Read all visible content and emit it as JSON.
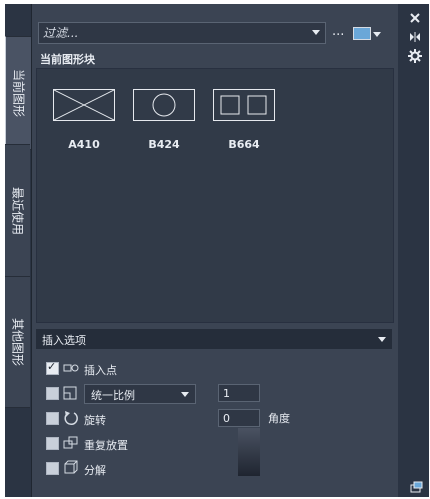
{
  "tabs": [
    {
      "label": "当前图形",
      "active": true
    },
    {
      "label": "最近使用",
      "active": false
    },
    {
      "label": "其他图形",
      "active": false
    }
  ],
  "filter": {
    "placeholder": "过滤...",
    "more_label": "..."
  },
  "section": {
    "title": "当前图形块"
  },
  "blocks": [
    {
      "name": "A410",
      "icon": "rectangle-cross-icon"
    },
    {
      "name": "B424",
      "icon": "rectangle-circle-icon"
    },
    {
      "name": "B664",
      "icon": "rectangle-two-squares-icon"
    }
  ],
  "insert_options": {
    "title": "插入选项",
    "insertion_point": {
      "label": "插入点",
      "checked": true
    },
    "scale": {
      "checked": false,
      "selected": "统一比例",
      "value": "1"
    },
    "rotation": {
      "label": "旋转",
      "checked": false,
      "value": "0",
      "unit_label": "角度"
    },
    "repeat": {
      "label": "重复放置",
      "checked": false
    },
    "explode": {
      "label": "分解",
      "checked": false
    }
  },
  "colors": {
    "panel": "#3b4453",
    "frame": "#2b3443",
    "text": "#e8ecf2",
    "accent": "#6aa7d8"
  }
}
